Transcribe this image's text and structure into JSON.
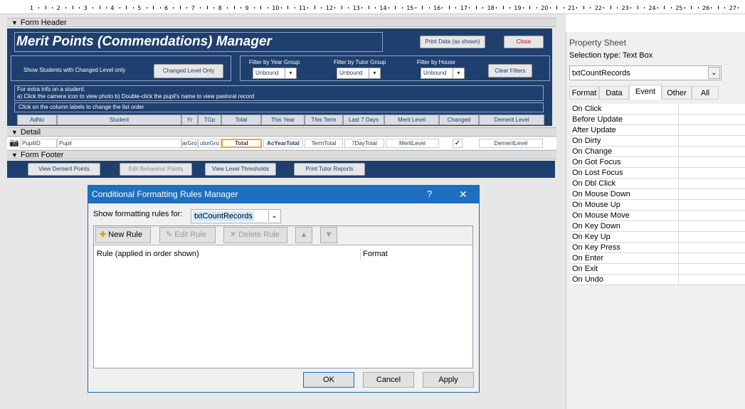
{
  "ruler": {
    "numbers": [
      "1",
      "2",
      "3",
      "4",
      "5",
      "6",
      "7",
      "8",
      "9",
      "10",
      "11",
      "12",
      "13",
      "14",
      "15",
      "16",
      "17",
      "18",
      "19",
      "20",
      "21",
      "22",
      "23",
      "24",
      "25",
      "26",
      "27"
    ]
  },
  "sections": {
    "form_header": "Form Header",
    "detail": "Detail",
    "form_footer": "Form Footer"
  },
  "header": {
    "title": "Merit Points (Commendations) Manager",
    "print_button": "Print Data (as shown)",
    "close_button": "Close",
    "show_changed_text": "Show Students with Changed Level only",
    "changed_level_button": "Changed Level Only",
    "filter_year_label": "Filter by Year Group",
    "filter_tutor_label": "Filter by Tutor Group",
    "filter_house_label": "Filter by House",
    "filter_year_value": "Unbound",
    "filter_tutor_value": "Unbound",
    "filter_house_value": "Unbound",
    "clear_filters_button": "Clear Filters",
    "info_line1": "For extra info on a student:",
    "info_line2": "a) Click the camera icon to view photo     b) Double-click the pupil's name to view pastoral record",
    "column_hint": "Click on the column labels to change the list order"
  },
  "columns": [
    "AdNo",
    "Student",
    "Yr",
    "TGp",
    "Total",
    "This Year",
    "This Term",
    "Last 7 Days",
    "Merit Level",
    "Changed",
    "Demerit Level"
  ],
  "detail_fields": {
    "pupil_id": "PupilID",
    "pupil": "Pupil",
    "year": "arGro",
    "tutor": "utorGro",
    "total": "Total",
    "ac_year": "AcYearTotal",
    "term": "TermTotal",
    "seven_day": "7DayTotal",
    "merit": "MeritLevel",
    "demerit": "DemeritLevel",
    "changed_checked": true
  },
  "footer": {
    "view_demerit": "View Demerit Points",
    "edit_behaviour": "Edit Behaviour Points",
    "view_level": "View Level Thresholds",
    "print_tutor": "Print Tutor Reports"
  },
  "property_sheet": {
    "title": "Property Sheet",
    "selection_label": "Selection type:",
    "selection_value": "Text Box",
    "object_value": "txtCountRecords",
    "tabs": [
      "Format",
      "Data",
      "Event",
      "Other",
      "All"
    ],
    "active_tab": "Event",
    "events": [
      "On Click",
      "Before Update",
      "After Update",
      "On Dirty",
      "On Change",
      "On Got Focus",
      "On Lost Focus",
      "On Dbl Click",
      "On Mouse Down",
      "On Mouse Up",
      "On Mouse Move",
      "On Key Down",
      "On Key Up",
      "On Key Press",
      "On Enter",
      "On Exit",
      "On Undo"
    ]
  },
  "dialog": {
    "title": "Conditional Formatting Rules Manager",
    "help": "?",
    "close": "✕",
    "show_rules_label": "Show formatting rules for:",
    "show_rules_value": "txtCountRecords",
    "new_rule": "New Rule",
    "edit_rule": "Edit Rule",
    "delete_rule": "Delete Rule",
    "col_rule": "Rule (applied in order shown)",
    "col_format": "Format",
    "ok": "OK",
    "cancel": "Cancel",
    "apply": "Apply"
  },
  "colors": {
    "navy": "#1f3f6e",
    "dialog_title": "#1e6fbf",
    "focus_orange": "#f5a623"
  }
}
